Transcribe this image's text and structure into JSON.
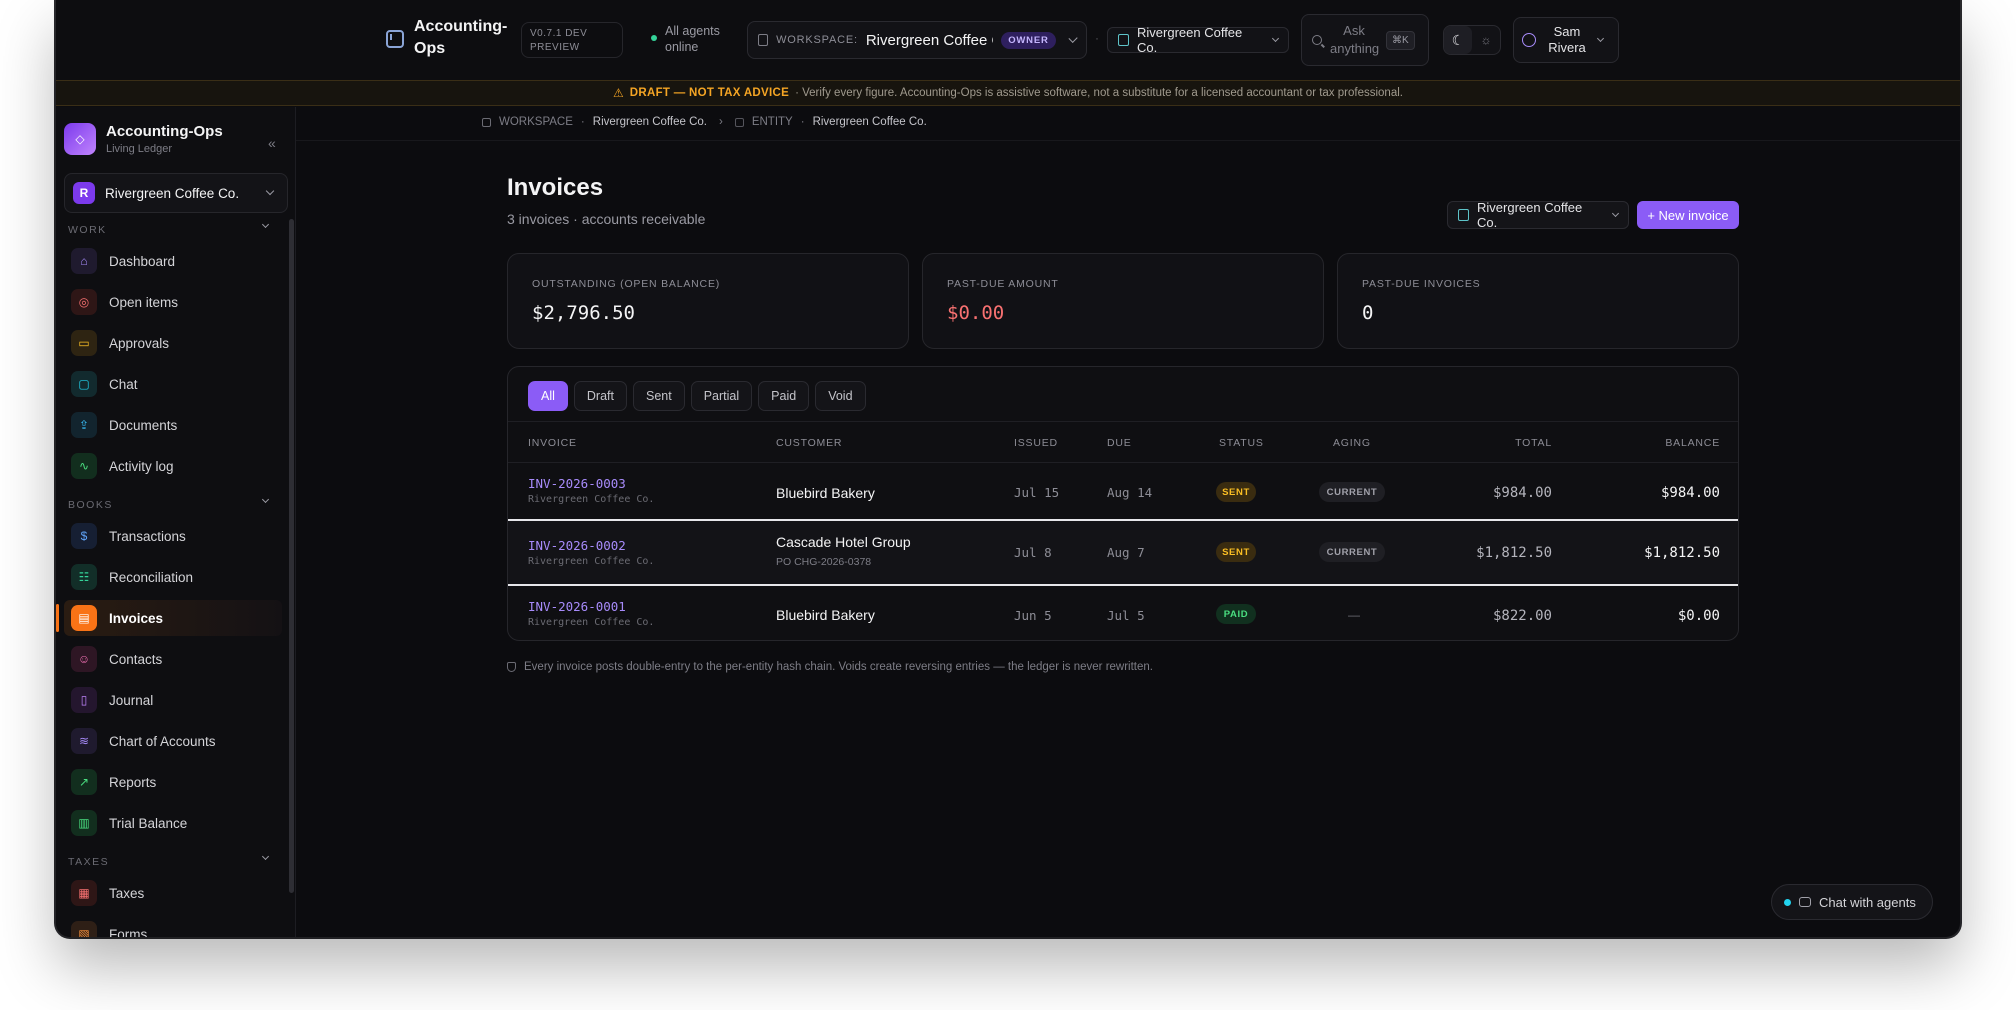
{
  "topbar": {
    "app_name": "Accounting-Ops",
    "version": "V0.7.1 DEV PREVIEW",
    "agents_status": "All agents online",
    "workspace_label": "WORKSPACE:",
    "workspace_value": "Rivergreen Coffee C…",
    "role_badge": "OWNER",
    "entity": "Rivergreen Coffee Co.",
    "ask_placeholder": "Ask anything",
    "ask_shortcut": "⌘K",
    "user_name": "Sam Rivera"
  },
  "banner": {
    "title": "DRAFT — NOT TAX ADVICE",
    "text": "· Verify every figure. Accounting-Ops is assistive software, not a substitute for a licensed accountant or tax professional."
  },
  "sidebar": {
    "brand_title": "Accounting-Ops",
    "brand_sub": "Living Ledger",
    "org_initial": "R",
    "org_name": "Rivergreen Coffee Co.",
    "sections": {
      "work": "WORK",
      "books": "BOOKS",
      "taxes": "TAXES"
    },
    "work_items": [
      "Dashboard",
      "Open items",
      "Approvals",
      "Chat",
      "Documents",
      "Activity log"
    ],
    "books_items": [
      "Transactions",
      "Reconciliation",
      "Invoices",
      "Contacts",
      "Journal",
      "Chart of Accounts",
      "Reports",
      "Trial Balance"
    ],
    "tax_items": [
      "Taxes",
      "Forms"
    ],
    "active_item": "Invoices"
  },
  "breadcrumb": {
    "workspace_label": "WORKSPACE",
    "workspace_value": "Rivergreen Coffee Co.",
    "entity_label": "ENTITY",
    "entity_value": "Rivergreen Coffee Co."
  },
  "page": {
    "title": "Invoices",
    "subtitle": "3 invoices · accounts receivable",
    "entity_selector": "Rivergreen Coffee Co.",
    "new_button": "+ New invoice"
  },
  "stats": [
    {
      "label": "OUTSTANDING (OPEN BALANCE)",
      "value": "$2,796.50"
    },
    {
      "label": "PAST-DUE AMOUNT",
      "value": "$0.00"
    },
    {
      "label": "PAST-DUE INVOICES",
      "value": "0"
    }
  ],
  "tabs": [
    "All",
    "Draft",
    "Sent",
    "Partial",
    "Paid",
    "Void"
  ],
  "active_tab": "All",
  "table": {
    "headers": [
      "INVOICE",
      "CUSTOMER",
      "ISSUED",
      "DUE",
      "STATUS",
      "AGING",
      "TOTAL",
      "BALANCE"
    ],
    "rows": [
      {
        "invoice": "INV-2026-0003",
        "entity": "Rivergreen Coffee Co.",
        "customer": "Bluebird Bakery",
        "po": "",
        "issued": "Jul 15",
        "due": "Aug 14",
        "status": "SENT",
        "aging": "CURRENT",
        "total": "$984.00",
        "balance": "$984.00"
      },
      {
        "invoice": "INV-2026-0002",
        "entity": "Rivergreen Coffee Co.",
        "customer": "Cascade Hotel Group",
        "po": "PO CHG-2026-0378",
        "issued": "Jul 8",
        "due": "Aug 7",
        "status": "SENT",
        "aging": "CURRENT",
        "total": "$1,812.50",
        "balance": "$1,812.50"
      },
      {
        "invoice": "INV-2026-0001",
        "entity": "Rivergreen Coffee Co.",
        "customer": "Bluebird Bakery",
        "po": "",
        "issued": "Jun 5",
        "due": "Jul 5",
        "status": "PAID",
        "aging": "—",
        "total": "$822.00",
        "balance": "$0.00"
      }
    ]
  },
  "footnote": "Every invoice posts double-entry to the per-entity hash chain. Voids create reversing entries — the ledger is never rewritten.",
  "chat_button": "Chat with agents",
  "colors": {
    "accent": "#8b5cf6",
    "active_nav": "#f97316",
    "danger": "#f87171",
    "warning": "#f5a524"
  }
}
